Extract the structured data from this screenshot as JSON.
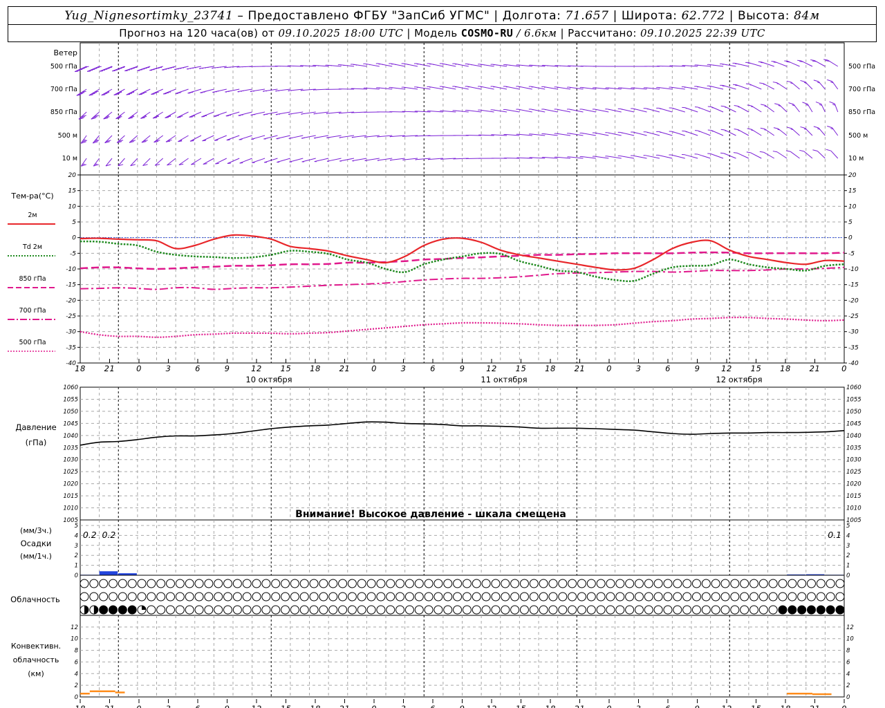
{
  "header": {
    "station": "Yug_Nignesortimky_23741",
    "provided": "Предоставлено ФГБУ \"ЗапСиб УГМС\"",
    "lon_label": "Долгота:",
    "lon_value": "71.657",
    "lat_label": "Широта:",
    "lat_value": "62.772",
    "alt_label": "Высота:",
    "alt_value": "84м",
    "forecast_label": "Прогноз на 120 часа(ов) от",
    "forecast_from": "09.10.2025 18:00 UTC",
    "model_label": "Модель",
    "model_name": "COSMO-RU",
    "model_res": "/ 6.6км",
    "computed_label": "Рассчитано:",
    "computed_value": "09.10.2025 22:39 UTC"
  },
  "colors": {
    "wind": "#7a1fd6",
    "t2m": "#e8262a",
    "td2m": "#1f8a1f",
    "t850": "#e0188c",
    "t700": "#e0188c",
    "t500": "#e0188c",
    "zero_line": "#3050e0",
    "precip": "#2244dd",
    "convective": "#ff8c1a",
    "pressure": "#000000",
    "grid": "#a8a8a8"
  },
  "x_axis": {
    "hour_ticks": [
      "18",
      "21",
      "0",
      "3",
      "6",
      "9",
      "12",
      "15",
      "18",
      "21",
      "0",
      "3",
      "6",
      "9",
      "12",
      "15",
      "18",
      "21",
      "0",
      "3",
      "6",
      "9",
      "12",
      "15",
      "18",
      "21",
      "0"
    ],
    "day_labels": [
      "10 октября",
      "11 октября",
      "12 октября"
    ]
  },
  "wind_panel": {
    "title": "Ветер",
    "levels": [
      "500 гПа",
      "700 гПа",
      "850 гПа",
      "500 м",
      "10   м"
    ]
  },
  "notice": "Внимание! Высокое давление - шкала смещена",
  "cloud_panel": {
    "title": "Облачность"
  },
  "chart_data": [
    {
      "type": "line",
      "title": "Тем-ра(°C)",
      "ylim": [
        -40,
        20
      ],
      "yticks": [
        20,
        15,
        10,
        5,
        0,
        -5,
        -10,
        -15,
        -20,
        -25,
        -30,
        -35,
        -40
      ],
      "x_hours": [
        0,
        3,
        6,
        9,
        12,
        15,
        18,
        21,
        24,
        27,
        30,
        33,
        36,
        39,
        42,
        45,
        48,
        51,
        54,
        57,
        60,
        63,
        66,
        69,
        72,
        75,
        78,
        81,
        84,
        87,
        90,
        93,
        96,
        99,
        102,
        105,
        108,
        111,
        114,
        117,
        120
      ],
      "series": [
        {
          "name": "2м",
          "style": "solid",
          "values": [
            -0.3,
            -0.2,
            -0.5,
            -0.7,
            -1.0,
            -3.5,
            -2.5,
            -0.5,
            0.8,
            0.5,
            -0.5,
            -2.8,
            -3.5,
            -4.3,
            -5.8,
            -7.0,
            -8.0,
            -6.0,
            -2.5,
            -0.5,
            -0.2,
            -1.5,
            -4.0,
            -5.5,
            -6.5,
            -7.5,
            -8.5,
            -9.5,
            -10.3,
            -9.8,
            -7.0,
            -3.5,
            -1.5,
            -1.0,
            -4.0,
            -6.0,
            -7.0,
            -8.0,
            -8.5,
            -7.3,
            -7.5
          ]
        },
        {
          "name": "Td 2м",
          "style": "dotted",
          "values": [
            -1.2,
            -1.3,
            -2.0,
            -2.5,
            -4.5,
            -5.5,
            -6.0,
            -6.2,
            -6.5,
            -6.3,
            -5.5,
            -4.2,
            -4.5,
            -5.2,
            -7.0,
            -8.0,
            -10.0,
            -11.0,
            -8.5,
            -7.0,
            -6.0,
            -5.0,
            -5.2,
            -7.5,
            -9.0,
            -10.5,
            -11.0,
            -12.5,
            -13.5,
            -13.8,
            -11.5,
            -9.5,
            -9.0,
            -8.8,
            -7.0,
            -8.5,
            -9.5,
            -10.0,
            -10.5,
            -9.0,
            -8.5
          ]
        },
        {
          "name": "850 гПа",
          "style": "dashed",
          "values": [
            -9.8,
            -9.5,
            -9.5,
            -9.8,
            -10.0,
            -9.8,
            -9.5,
            -9.3,
            -9.0,
            -9.0,
            -8.8,
            -8.5,
            -8.5,
            -8.4,
            -8.0,
            -8.0,
            -7.8,
            -7.5,
            -7.0,
            -6.8,
            -6.5,
            -6.3,
            -6.0,
            -5.8,
            -5.5,
            -5.5,
            -5.3,
            -5.2,
            -5.0,
            -5.0,
            -5.0,
            -5.0,
            -4.8,
            -4.7,
            -4.8,
            -5.0,
            -5.0,
            -5.0,
            -5.0,
            -5.0,
            -4.8
          ]
        },
        {
          "name": "700 гПа",
          "style": "dashdot",
          "values": [
            -16.3,
            -16.2,
            -16.0,
            -16.2,
            -16.5,
            -16.0,
            -16.0,
            -16.5,
            -16.2,
            -16.0,
            -16.0,
            -15.8,
            -15.5,
            -15.2,
            -15.0,
            -14.8,
            -14.5,
            -14.0,
            -13.5,
            -13.2,
            -13.0,
            -13.0,
            -12.8,
            -12.5,
            -12.0,
            -11.5,
            -11.3,
            -11.2,
            -11.0,
            -10.8,
            -10.8,
            -11.0,
            -10.8,
            -10.5,
            -10.5,
            -10.5,
            -10.3,
            -10.0,
            -10.0,
            -9.8,
            -9.5
          ]
        },
        {
          "name": "500 гПа",
          "style": "dense-dotted",
          "values": [
            -30.0,
            -31.0,
            -31.5,
            -31.5,
            -31.8,
            -31.5,
            -31.0,
            -30.8,
            -30.5,
            -30.5,
            -30.5,
            -30.7,
            -30.5,
            -30.3,
            -29.8,
            -29.3,
            -28.8,
            -28.3,
            -27.8,
            -27.5,
            -27.2,
            -27.2,
            -27.3,
            -27.5,
            -27.8,
            -28.0,
            -28.0,
            -28.0,
            -27.8,
            -27.3,
            -26.8,
            -26.5,
            -26.0,
            -25.8,
            -25.5,
            -25.5,
            -25.8,
            -26.0,
            -26.3,
            -26.5,
            -26.3
          ]
        }
      ],
      "zero_line": true
    },
    {
      "type": "line",
      "title": "Давление",
      "ylabel": "(гПа)",
      "ylim": [
        1005,
        1060
      ],
      "yticks": [
        1060,
        1055,
        1050,
        1045,
        1040,
        1035,
        1030,
        1025,
        1020,
        1015,
        1010,
        1005
      ],
      "x_hours": [
        0,
        3,
        6,
        9,
        12,
        15,
        18,
        21,
        24,
        27,
        30,
        33,
        36,
        39,
        42,
        45,
        48,
        51,
        54,
        57,
        60,
        63,
        66,
        69,
        72,
        75,
        78,
        81,
        84,
        87,
        90,
        93,
        96,
        99,
        102,
        105,
        108,
        111,
        114,
        117,
        120
      ],
      "series": [
        {
          "name": "Давление",
          "values": [
            1036.0,
            1037.2,
            1037.5,
            1038.3,
            1039.3,
            1039.8,
            1039.8,
            1040.2,
            1040.8,
            1041.8,
            1042.8,
            1043.5,
            1044.0,
            1044.3,
            1045.0,
            1045.6,
            1045.5,
            1045.0,
            1044.8,
            1044.5,
            1044.0,
            1044.0,
            1043.8,
            1043.5,
            1043.0,
            1043.0,
            1043.0,
            1042.8,
            1042.5,
            1042.2,
            1041.5,
            1040.8,
            1040.5,
            1040.8,
            1041.0,
            1041.0,
            1041.2,
            1041.2,
            1041.3,
            1041.5,
            1042.0
          ]
        }
      ]
    },
    {
      "type": "bar",
      "title": "Осадки",
      "ylabel_top": "(мм/3ч.)",
      "ylabel_bottom": "(мм/1ч.)",
      "ylim": [
        0,
        5
      ],
      "yticks": [
        5,
        4,
        3,
        2,
        1,
        0
      ],
      "x_hours": [
        3,
        6,
        9,
        114,
        117,
        120
      ],
      "values": [
        0.05,
        0.4,
        0.2,
        0.08,
        0.1,
        0.05
      ],
      "annotations": [
        {
          "x_hour": 1.5,
          "text": "0.2"
        },
        {
          "x_hour": 4.5,
          "text": "0.2"
        },
        {
          "x_hour": 118.5,
          "text": "0.1"
        }
      ]
    },
    {
      "type": "table",
      "title": "Облачность",
      "rows": 3,
      "count": 80,
      "row3_partial_fraction": {
        "0": 0.5,
        "1": 0.5,
        "6": 0.25
      },
      "row3_filled_indices": [
        2,
        3,
        4,
        5,
        73,
        74,
        75,
        76,
        77,
        78,
        79
      ]
    },
    {
      "type": "bar",
      "title": "Конвективн.",
      "ylabel_mid": "облачность",
      "ylabel": "(км)",
      "ylim": [
        0,
        14
      ],
      "yticks": [
        12,
        10,
        8,
        6,
        4,
        2,
        0
      ],
      "segments": [
        {
          "x0_hour": 0,
          "x1_hour": 1.5,
          "value": 0.6
        },
        {
          "x0_hour": 1.5,
          "x1_hour": 5.5,
          "value": 1.0
        },
        {
          "x0_hour": 5.5,
          "x1_hour": 7,
          "value": 0.8
        },
        {
          "x0_hour": 111,
          "x1_hour": 115,
          "value": 0.6
        },
        {
          "x0_hour": 115,
          "x1_hour": 118,
          "value": 0.5
        }
      ]
    }
  ],
  "wind_data": {
    "x_hours": [
      0,
      6,
      12,
      18,
      24,
      30,
      36,
      42,
      48,
      54,
      60,
      66,
      72,
      78,
      84,
      90,
      96,
      102,
      108,
      114,
      120
    ],
    "levels": [
      {
        "name": "500 гПа",
        "dir_deg": [
          230,
          235,
          240,
          250,
          260,
          270,
          275,
          280,
          290,
          290,
          290,
          285,
          280,
          275,
          270,
          270,
          275,
          285,
          300,
          310,
          320
        ],
        "speed_kt": [
          60,
          55,
          50,
          45,
          40,
          35,
          30,
          30,
          25,
          25,
          25,
          25,
          25,
          30,
          30,
          30,
          25,
          25,
          20,
          20,
          20
        ]
      },
      {
        "name": "700 гПа",
        "dir_deg": [
          220,
          225,
          230,
          240,
          250,
          255,
          260,
          270,
          280,
          285,
          290,
          290,
          290,
          285,
          280,
          280,
          285,
          295,
          310,
          330,
          340
        ],
        "speed_kt": [
          40,
          35,
          30,
          25,
          25,
          20,
          20,
          20,
          20,
          20,
          20,
          20,
          20,
          20,
          20,
          20,
          20,
          20,
          15,
          15,
          15
        ]
      },
      {
        "name": "850 гПа",
        "dir_deg": [
          210,
          215,
          220,
          230,
          240,
          250,
          255,
          260,
          270,
          275,
          280,
          285,
          290,
          290,
          290,
          295,
          300,
          310,
          320,
          340,
          350
        ],
        "speed_kt": [
          30,
          25,
          25,
          20,
          20,
          20,
          15,
          15,
          15,
          15,
          15,
          15,
          15,
          15,
          15,
          15,
          15,
          15,
          15,
          15,
          15
        ]
      },
      {
        "name": "500 м",
        "dir_deg": [
          200,
          210,
          215,
          225,
          235,
          245,
          250,
          255,
          260,
          265,
          270,
          275,
          280,
          285,
          290,
          295,
          300,
          310,
          320,
          330,
          340
        ],
        "speed_kt": [
          25,
          20,
          20,
          15,
          15,
          15,
          15,
          15,
          15,
          15,
          15,
          15,
          15,
          15,
          15,
          15,
          15,
          15,
          15,
          15,
          15
        ]
      },
      {
        "name": "10 м",
        "dir_deg": [
          200,
          205,
          210,
          220,
          230,
          240,
          245,
          250,
          255,
          260,
          265,
          270,
          275,
          280,
          285,
          290,
          295,
          305,
          315,
          325,
          335
        ],
        "speed_kt": [
          15,
          10,
          10,
          10,
          10,
          10,
          10,
          10,
          10,
          10,
          10,
          10,
          10,
          10,
          10,
          10,
          10,
          10,
          10,
          10,
          10
        ]
      }
    ]
  }
}
